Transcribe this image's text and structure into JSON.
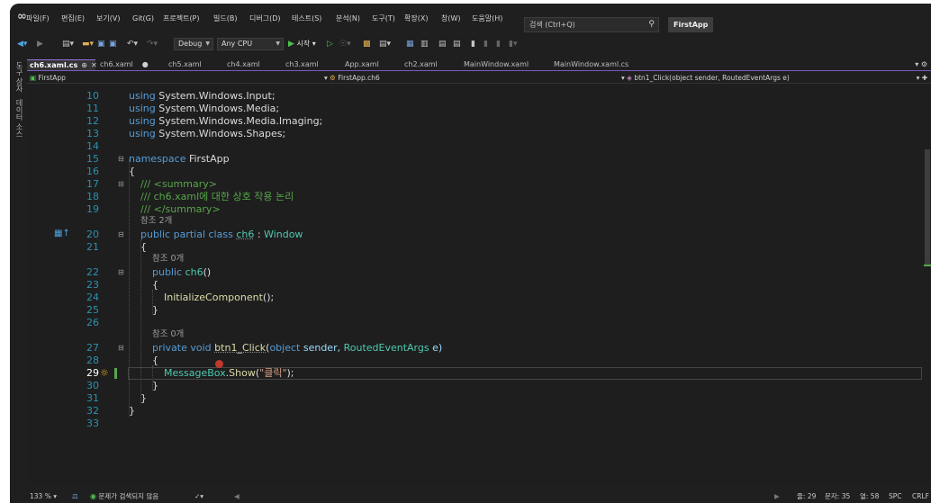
{
  "menubar": {
    "items": [
      "파일(F)",
      "편집(E)",
      "보기(V)",
      "Git(G)",
      "프로젝트(P)",
      "빌드(B)",
      "디버그(D)",
      "테스트(S)",
      "분석(N)",
      "도구(T)",
      "확장(X)",
      "창(W)",
      "도움말(H)"
    ],
    "search_placeholder": "검색 (Ctrl+Q)",
    "app_name": "FirstApp"
  },
  "toolbar": {
    "config": "Debug",
    "platform": "Any CPU",
    "start_label": "시작"
  },
  "side_panel": {
    "labels": [
      "도구 상자",
      "데이터 소스"
    ]
  },
  "tabs": [
    {
      "label": "ch6.xaml.cs",
      "active": true
    },
    {
      "label": "ch6.xaml",
      "active": false
    },
    {
      "label": "ch5.xaml",
      "active": false
    },
    {
      "label": "ch4.xaml",
      "active": false
    },
    {
      "label": "ch3.xaml",
      "active": false
    },
    {
      "label": "App.xaml",
      "active": false
    },
    {
      "label": "ch2.xaml",
      "active": false
    },
    {
      "label": "MainWindow.xaml",
      "active": false
    },
    {
      "label": "MainWindow.xaml.cs",
      "active": false
    }
  ],
  "navbar": {
    "project": "FirstApp",
    "class": "FirstApp.ch6",
    "member": "btn1_Click(object sender, RoutedEventArgs e)"
  },
  "editor": {
    "line_numbers": [
      "10",
      "11",
      "12",
      "13",
      "14",
      "15",
      "16",
      "17",
      "18",
      "19",
      "20",
      "21",
      "22",
      "23",
      "24",
      "25",
      "26",
      "27",
      "28",
      "29",
      "30",
      "31",
      "32",
      "33"
    ],
    "ref_2": "참조 2개",
    "ref_0a": "참조 0개",
    "ref_0b": "참조 0개",
    "using_kw": "using",
    "using_1": "System.Windows.Input;",
    "using_2": "System.Windows.Media;",
    "using_3": "System.Windows.Media.Imaging;",
    "using_4": "System.Windows.Shapes;",
    "namespace_kw": "namespace",
    "namespace_name": "FirstApp",
    "brace_open": "{",
    "brace_close": "}",
    "comment_1": "/// <summary>",
    "comment_2": "/// ch6.xaml에 대한 상호 작용 논리",
    "comment_3": "/// </summary>",
    "class_kw": "public partial class",
    "class_name": "ch6",
    "class_sep": " : ",
    "class_base": "Window",
    "ctor_kw": "public",
    "ctor_name": "ch6",
    "ctor_parens": "()",
    "init_call": "InitializeComponent",
    "init_tail": "();",
    "method_kw": "private void",
    "method_name": "btn1_Click",
    "param_open": "(",
    "param_type1": "object",
    "param_name1": " sender, ",
    "param_type2": "RoutedEventArgs",
    "param_name2": " e)",
    "msgbox_class": "MessageBox",
    "msgbox_dot": ".",
    "msgbox_method": "Show",
    "msgbox_open": "(",
    "msgbox_str": "\"클릭\"",
    "msgbox_close": ");"
  },
  "status": {
    "zoom": "133 %",
    "issues": "문제가 검색되지 않음",
    "line": "줄: 29",
    "char": "문자: 35",
    "col": "열: 58",
    "spc": "SPC",
    "eol": "CRLF"
  },
  "colors": {
    "accent": "#7e57c2",
    "keyword": "#569cd6",
    "type": "#4ec9b0",
    "comment": "#57a64a",
    "string": "#d69d85",
    "line_number": "#2b91af"
  }
}
